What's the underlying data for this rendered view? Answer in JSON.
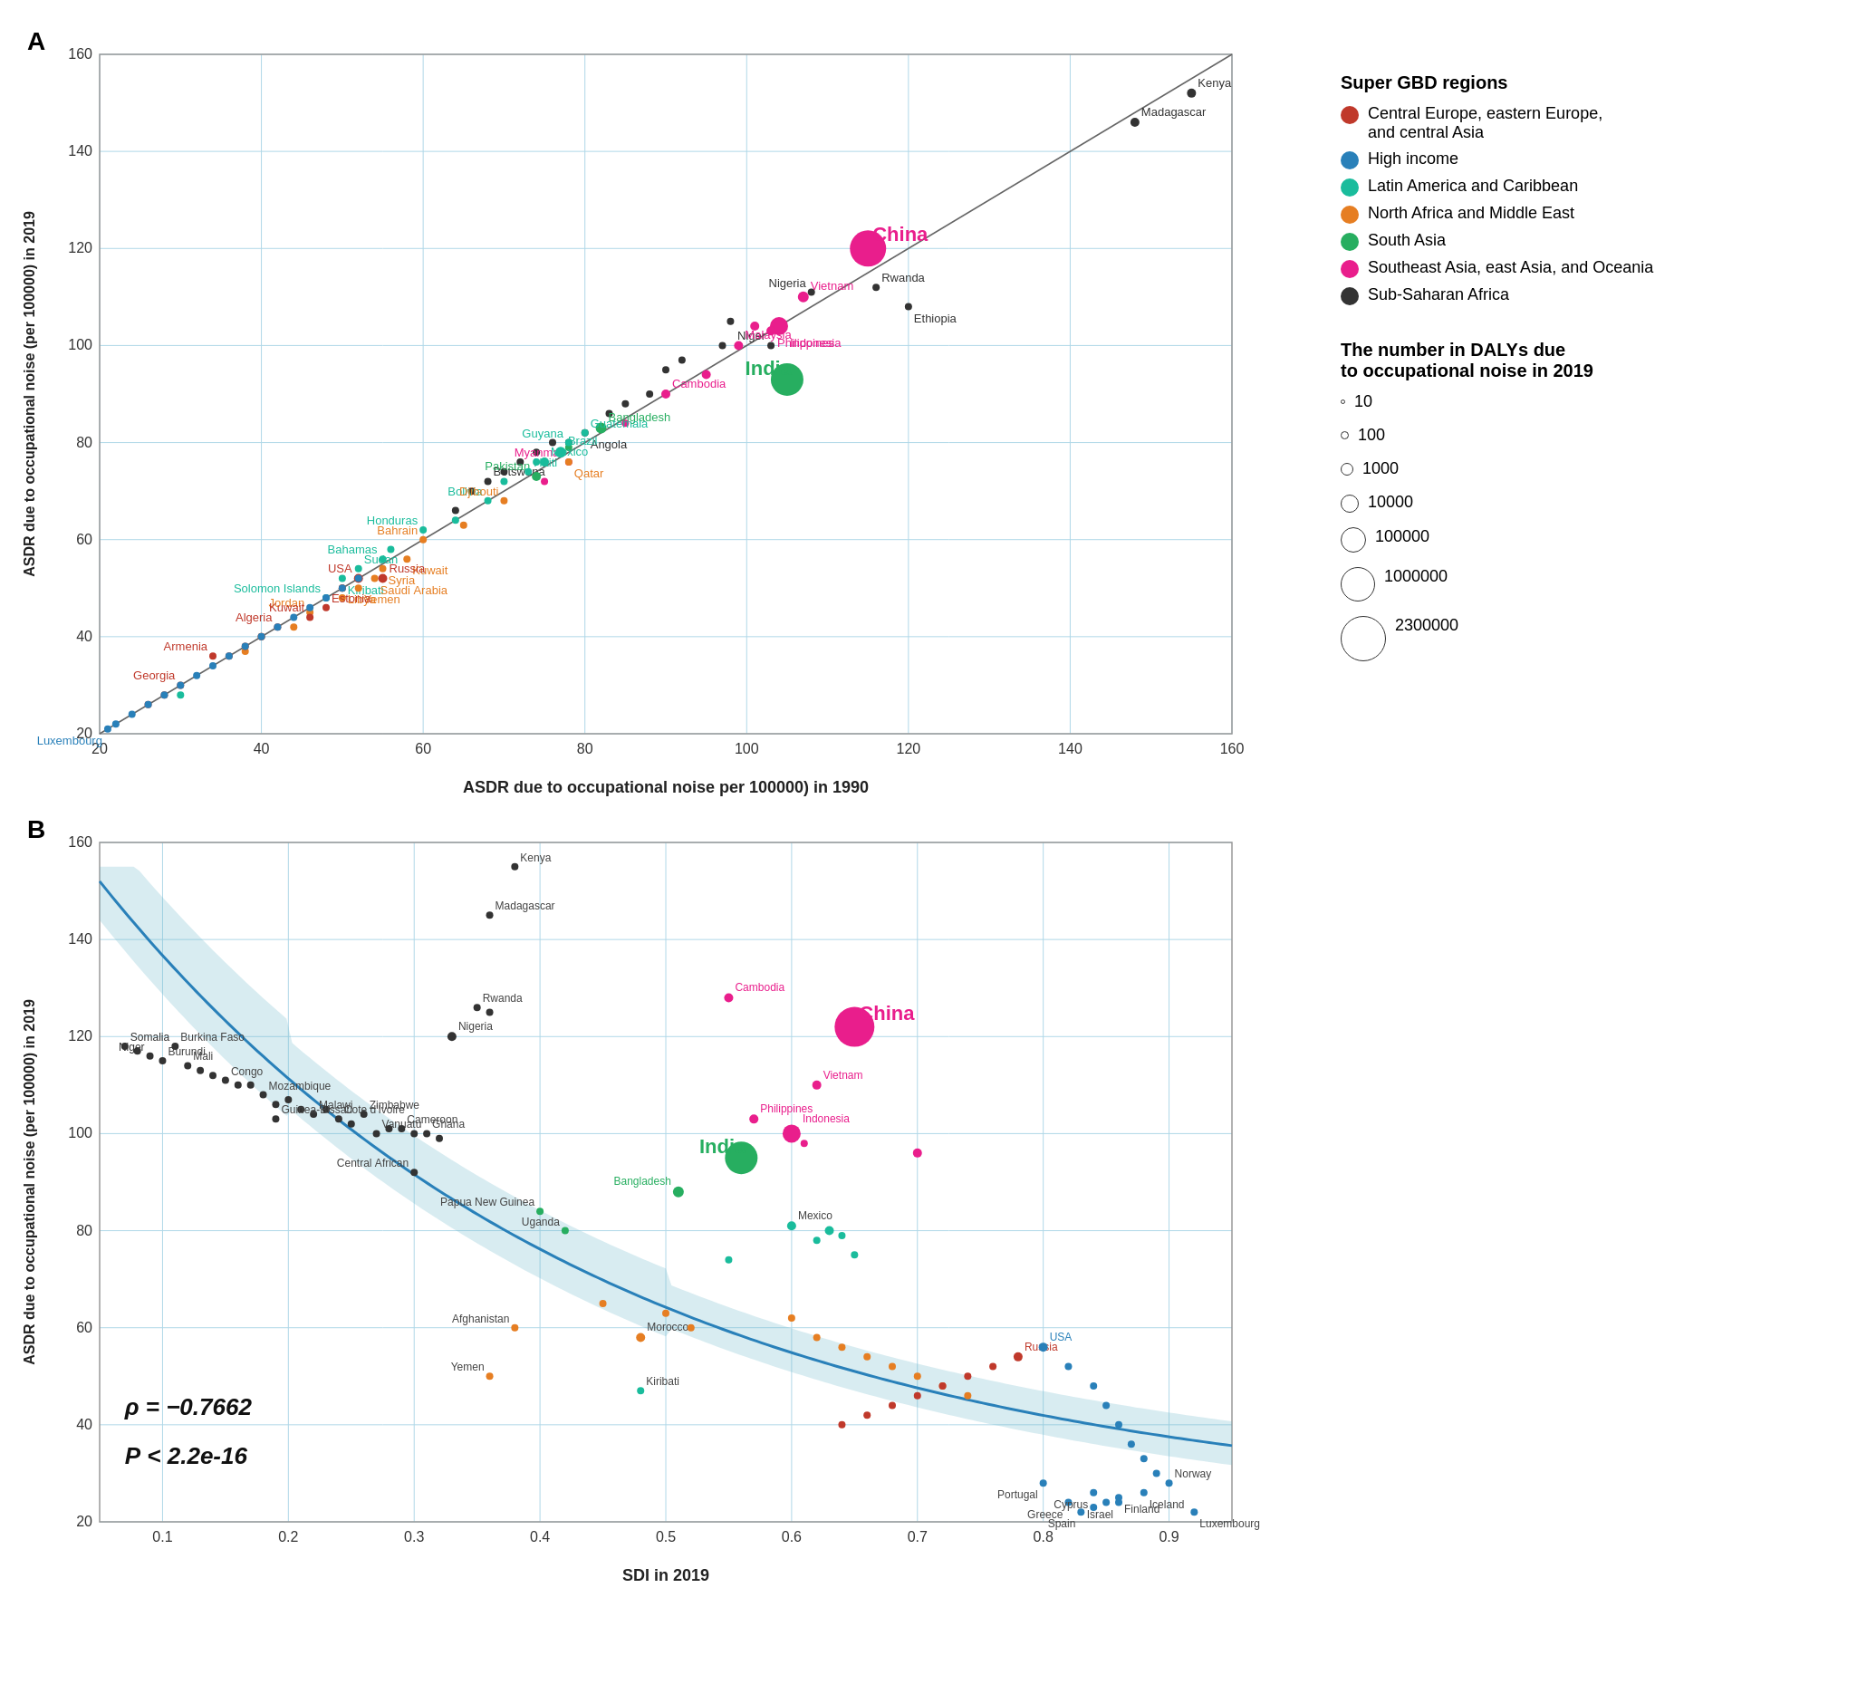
{
  "panels": {
    "A": {
      "label": "A",
      "x_axis": "ASDR due to occupational noise per 100000) in 1990",
      "y_axis": "ASDR due to occupational noise (per 100000) in 2019",
      "x_range": [
        20,
        160
      ],
      "y_range": [
        20,
        160
      ]
    },
    "B": {
      "label": "B",
      "x_axis": "SDI in 2019",
      "y_axis": "ASDR due to occupational noise (per 100000) in 2019",
      "x_range": [
        0.05,
        0.95
      ],
      "y_range": [
        20,
        160
      ],
      "rho": "ρ = −0.7662",
      "p_value": "P < 2.2e-16"
    }
  },
  "legend": {
    "regions_title": "Super GBD regions",
    "regions": [
      {
        "name": "Central Europe, eastern Europe, and central Asia",
        "color": "#c0392b"
      },
      {
        "name": "High income",
        "color": "#2980b9"
      },
      {
        "name": "Latin America and Caribbean",
        "color": "#1abc9c"
      },
      {
        "name": "North Africa and Middle East",
        "color": "#e67e22"
      },
      {
        "name": "South Asia",
        "color": "#27ae60"
      },
      {
        "name": "Southeast Asia, east Asia, and Oceania",
        "color": "#e91e8c"
      },
      {
        "name": "Sub-Saharan Africa",
        "color": "#333333"
      }
    ],
    "dalys_title": "The number in DALYs due\nto occupational noise in 2019",
    "daly_sizes": [
      {
        "label": "10",
        "r": 2
      },
      {
        "label": "100",
        "r": 4
      },
      {
        "label": "1000",
        "r": 6
      },
      {
        "label": "10000",
        "r": 9
      },
      {
        "label": "100000",
        "r": 13
      },
      {
        "label": "1000000",
        "r": 18
      },
      {
        "label": "2300000",
        "r": 24
      }
    ]
  }
}
